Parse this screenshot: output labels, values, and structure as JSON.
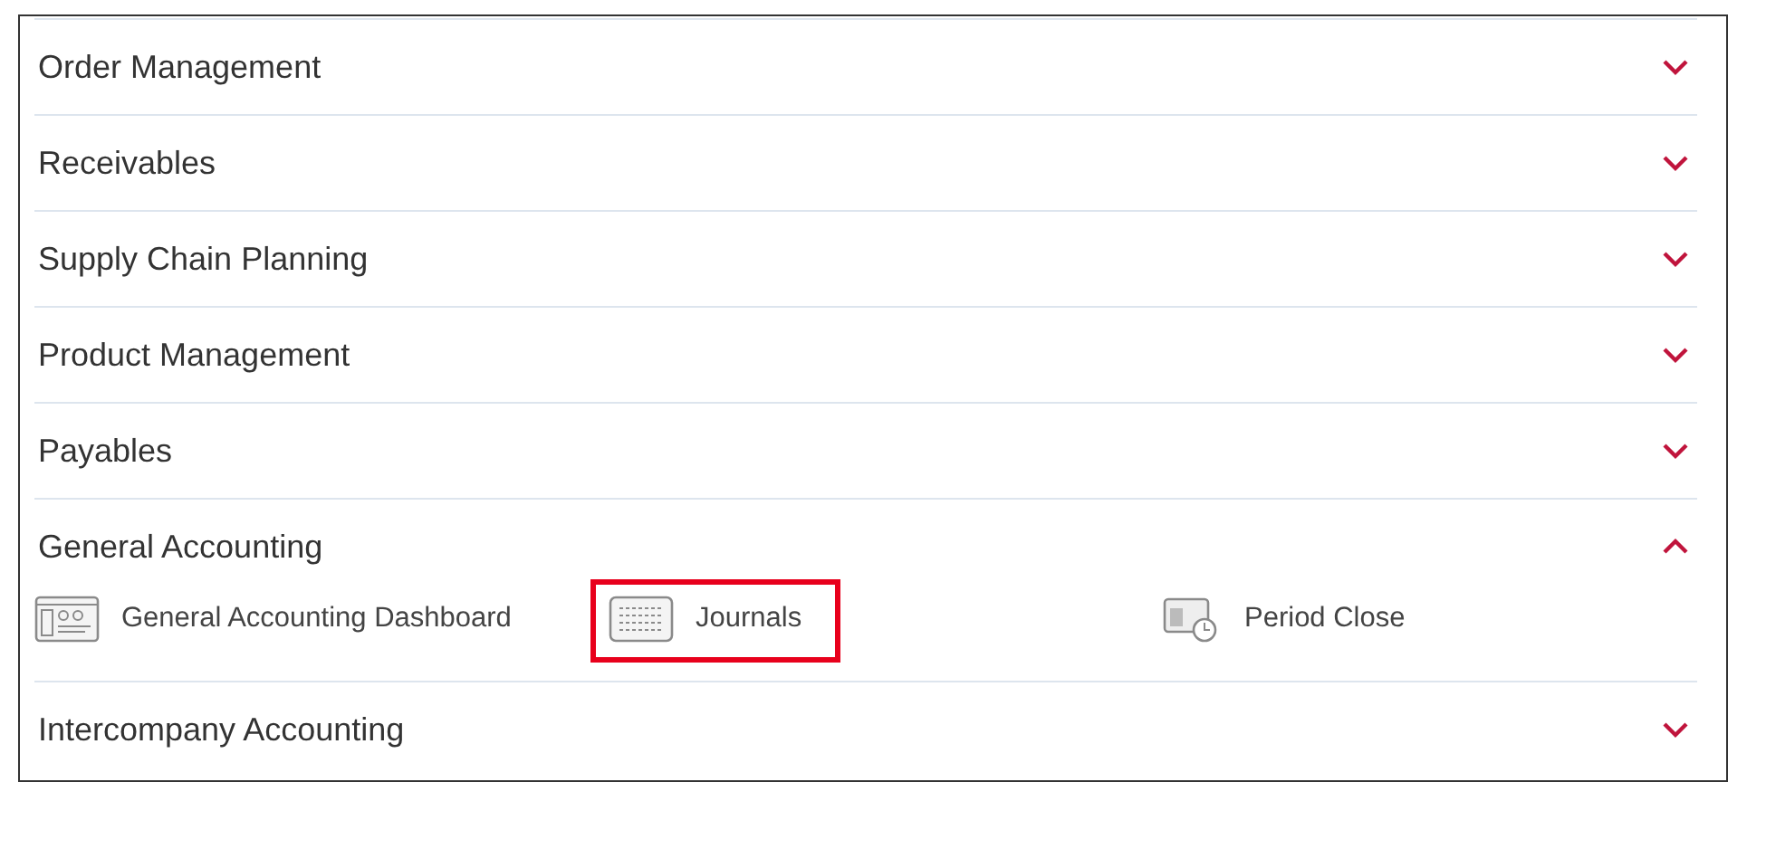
{
  "sections": [
    {
      "title": "Order Management",
      "expanded": false
    },
    {
      "title": "Receivables",
      "expanded": false
    },
    {
      "title": "Supply Chain Planning",
      "expanded": false
    },
    {
      "title": "Product Management",
      "expanded": false
    },
    {
      "title": "Payables",
      "expanded": false
    },
    {
      "title": "General Accounting",
      "expanded": true,
      "items": [
        {
          "label": "General Accounting Dashboard",
          "kind": "dashboard",
          "highlighted": false
        },
        {
          "label": "Journals",
          "kind": "journal",
          "highlighted": true
        },
        {
          "label": "Period Close",
          "kind": "period",
          "highlighted": false
        }
      ]
    },
    {
      "title": "Intercompany Accounting",
      "expanded": false
    }
  ]
}
